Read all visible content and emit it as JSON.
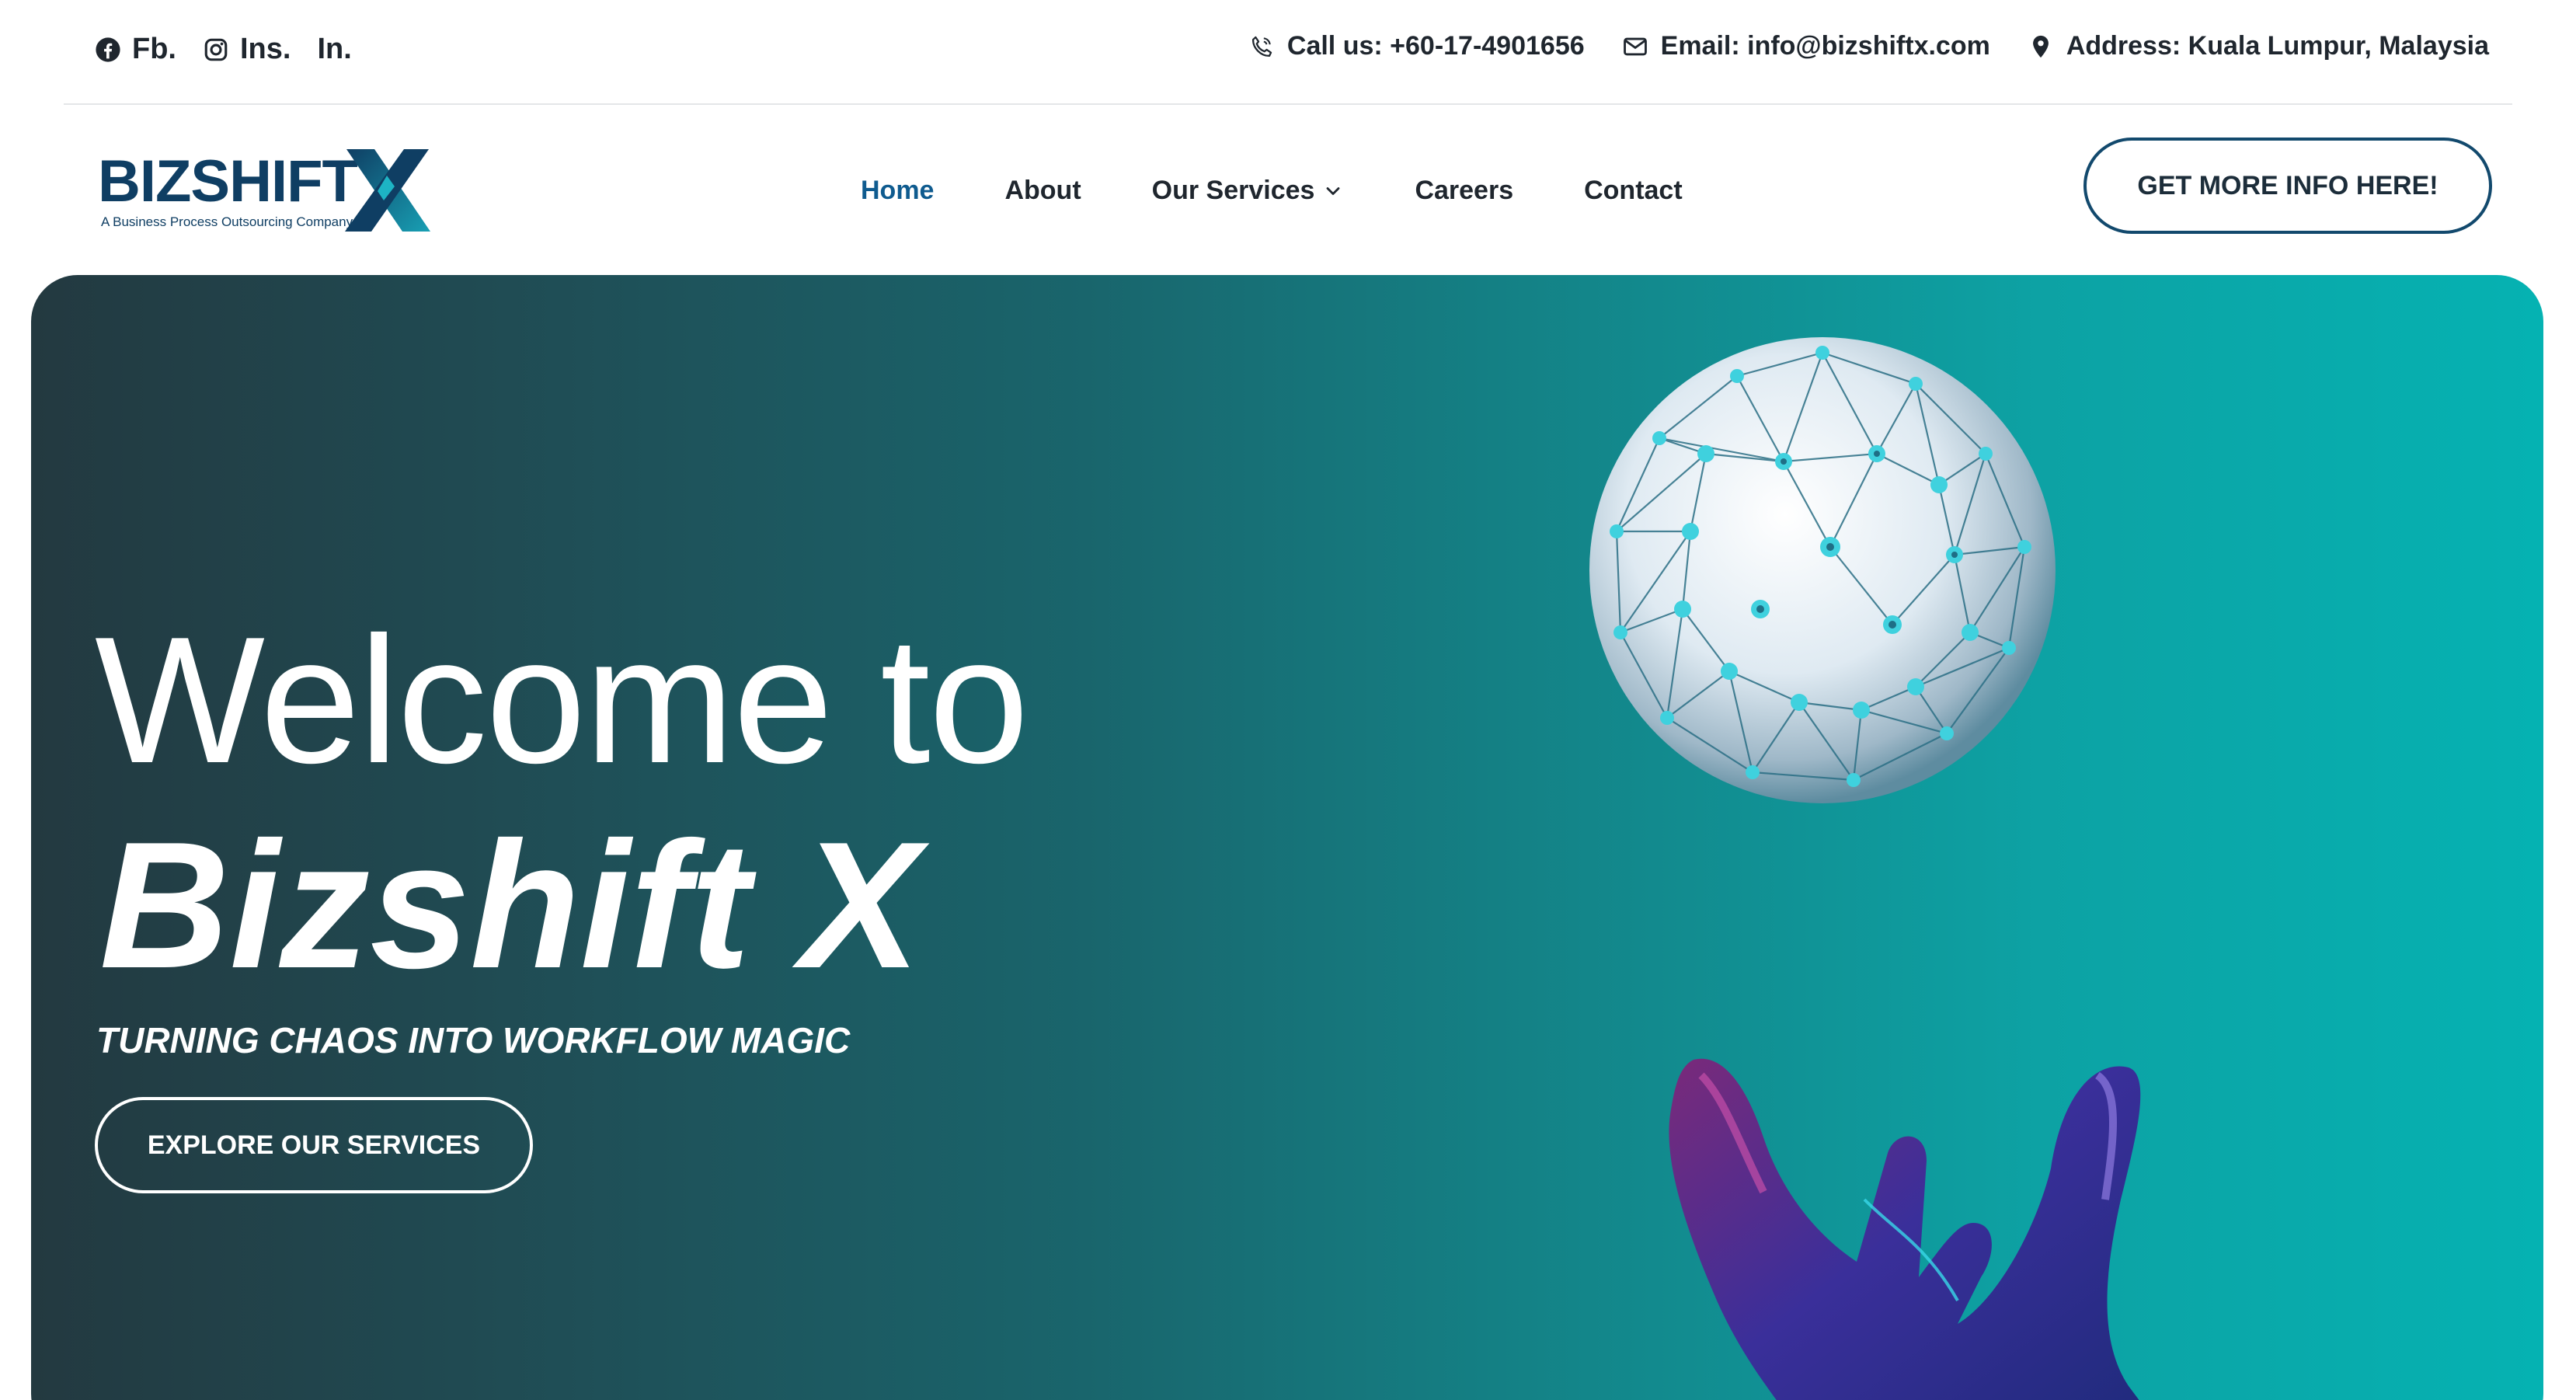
{
  "colors": {
    "brand_navy": "#0f3e63",
    "nav_active": "#0f5b8f",
    "hero_start": "#233940",
    "hero_end": "#05b2b2"
  },
  "topbar": {
    "social": [
      {
        "icon": "facebook-icon",
        "label": "Fb."
      },
      {
        "icon": "instagram-icon",
        "label": "Ins."
      },
      {
        "label": "In."
      }
    ],
    "phone": "Call us: +60-17-4901656",
    "email": "Email: info@bizshiftx.com",
    "address": "Address: Kuala Lumpur, Malaysia"
  },
  "logo": {
    "word": "BIZSHIFT",
    "mark": "X",
    "tagline": "A Business Process Outsourcing Company"
  },
  "nav": {
    "items": [
      {
        "label": "Home",
        "active": true
      },
      {
        "label": "About"
      },
      {
        "label": "Our Services",
        "has_dropdown": true
      },
      {
        "label": "Careers"
      },
      {
        "label": "Contact"
      }
    ],
    "cta": "GET MORE INFO HERE!"
  },
  "hero": {
    "title_line1": "Welcome to",
    "title_line2": "Bizshift X",
    "subtitle": "TURNING CHAOS INTO WORKFLOW MAGIC",
    "button": "EXPLORE OUR SERVICES",
    "images": [
      "network-sphere",
      "robotic-hand"
    ]
  }
}
